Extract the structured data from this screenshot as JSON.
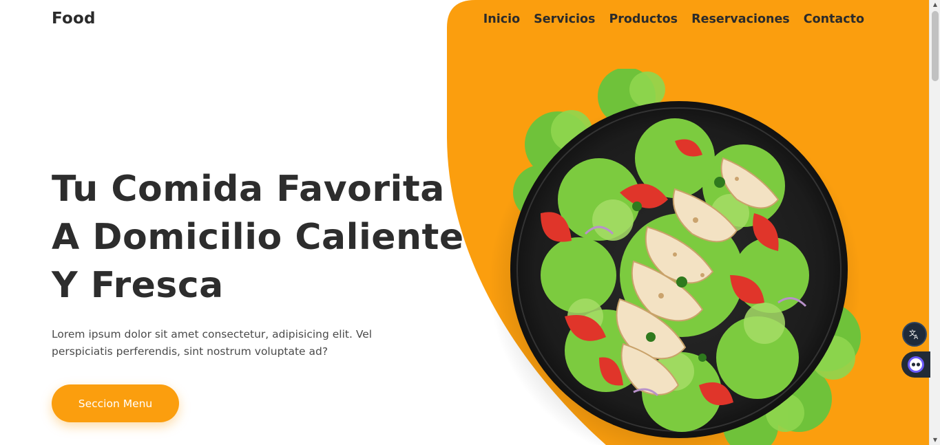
{
  "brand": {
    "logo": "Food"
  },
  "nav": {
    "items": [
      "Inicio",
      "Servicios",
      "Productos",
      "Reservaciones",
      "Contacto"
    ]
  },
  "hero": {
    "headline_lines": [
      "Tu Comida Favorita",
      "A Domicilio Caliente",
      "Y Fresca"
    ],
    "lead": "Lorem ipsum dolor sit amet consectetur, adipisicing elit. Vel perspiciatis perferendis, sint nostrum voluptate ad?",
    "cta_label": "Seccion Menu",
    "image_subject": "salad-bowl-image"
  },
  "colors": {
    "accent": "#fb9e0e",
    "text_dark": "#2d2d2d",
    "text_body": "#4a4a4a",
    "background": "#ffffff"
  },
  "widgets": {
    "translate_icon": "translate-icon",
    "assistant_icon": "assistant-icon"
  }
}
